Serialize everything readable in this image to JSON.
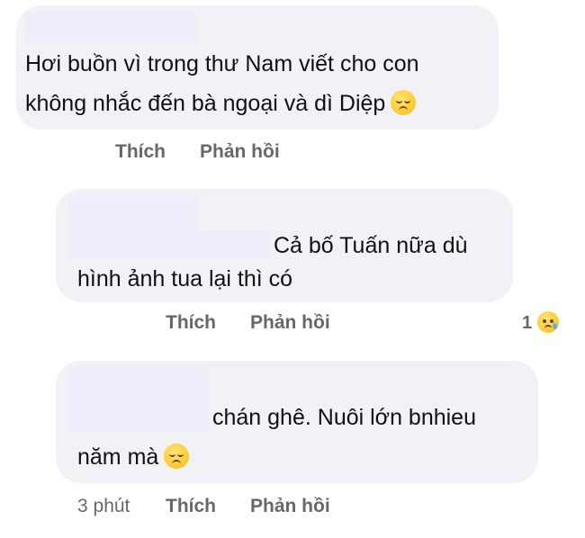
{
  "comments": [
    {
      "line1": "Hơi buồn vì trong thư Nam viết cho con",
      "line2": "không nhắc đến bà ngoại và dì Diệp",
      "emoji": "pensive-face-icon",
      "actions": {
        "like": "Thích",
        "reply": "Phản hồi"
      }
    },
    {
      "line1": "Cả bố Tuấn nữa dù",
      "line2": "hình ảnh tua lại thì có",
      "actions": {
        "like": "Thích",
        "reply": "Phản hồi"
      },
      "reaction": {
        "count": "1",
        "emoji": "crying-face-icon"
      }
    },
    {
      "line1": "chán ghê. Nuôi lớn bnhieu",
      "line2": "năm mà",
      "emoji": "pensive-face-icon",
      "actions": {
        "time": "3 phút",
        "like": "Thích",
        "reply": "Phản hồi"
      }
    }
  ]
}
